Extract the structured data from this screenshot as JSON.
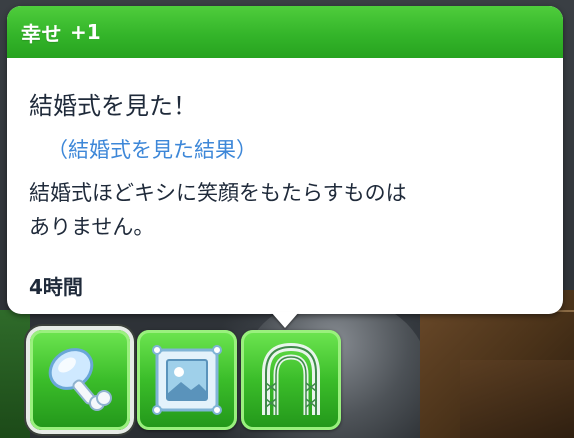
{
  "header": {
    "emotion_label": "幸せ",
    "emotion_value": "+1",
    "color": "#34b52a"
  },
  "moodlet": {
    "title": "結婚式を見た！",
    "cause": "（結婚式を見た結果）",
    "description_line1": "結婚式ほどキシに笑顔をもたらすものは",
    "description_line2": "ありません。",
    "duration": "4時間",
    "cause_color": "#3d87d8"
  },
  "moodlet_icons": [
    {
      "name": "drumstick-icon",
      "selected": true
    },
    {
      "name": "picture-frame-icon",
      "selected": false
    },
    {
      "name": "wedding-arch-icon",
      "selected": false
    }
  ]
}
